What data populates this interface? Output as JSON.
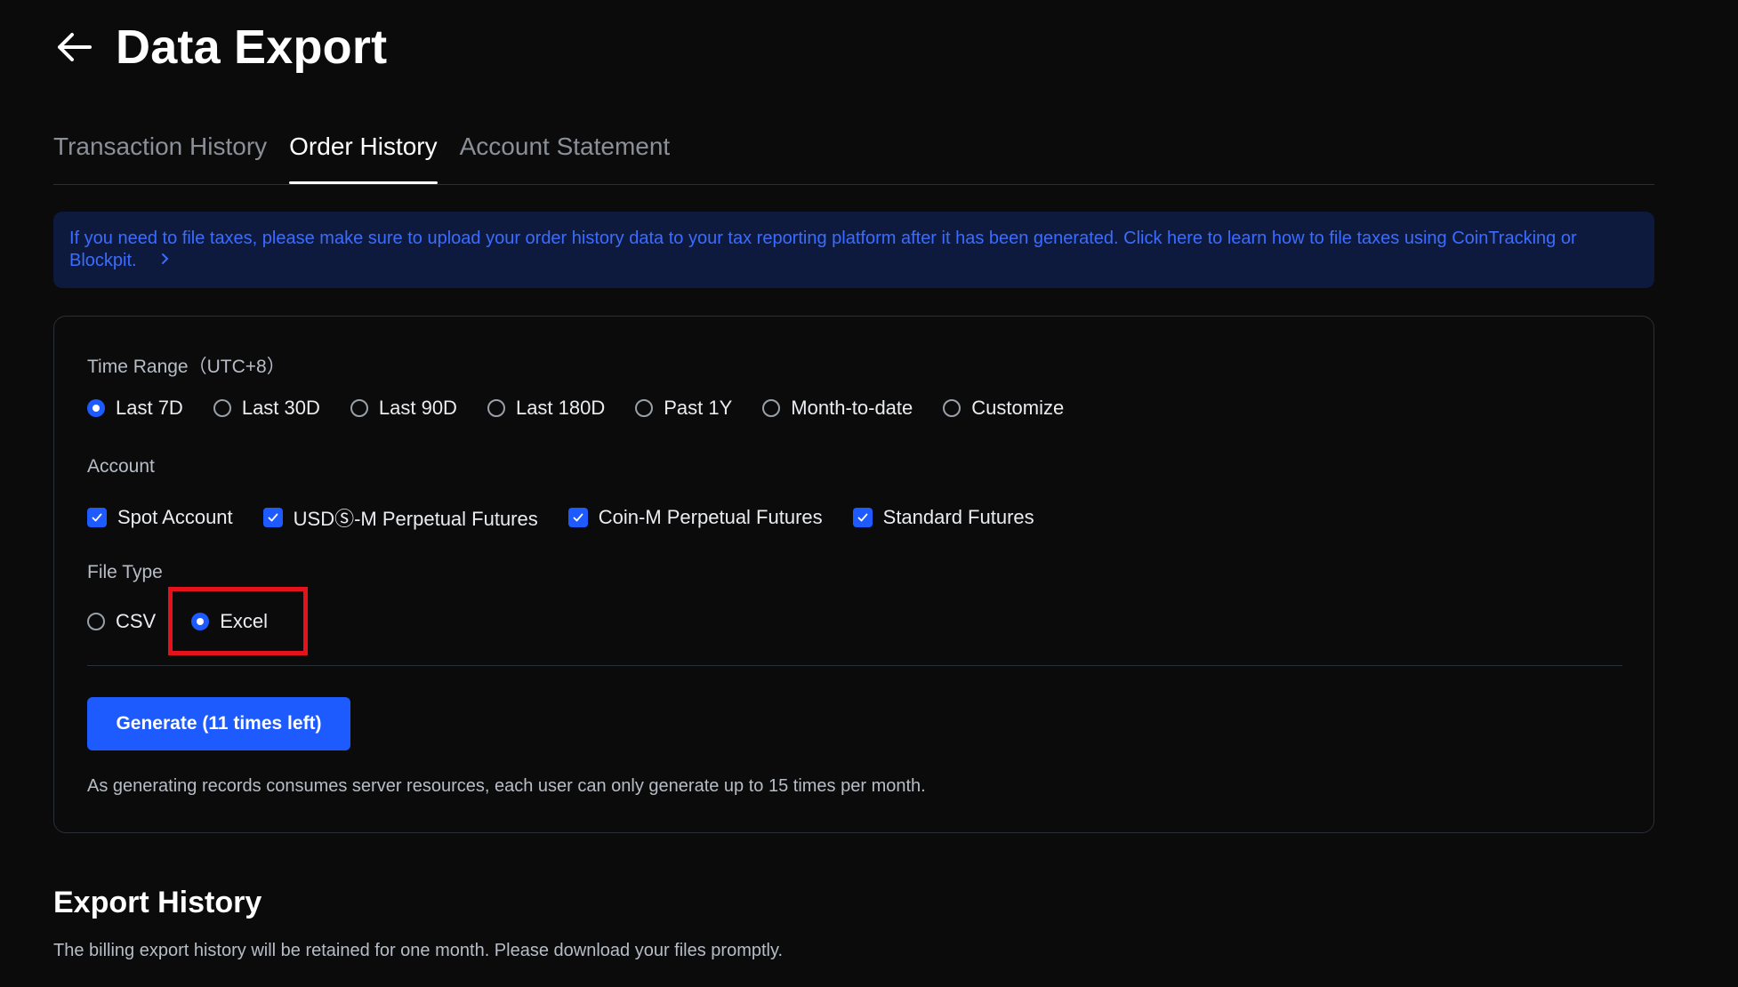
{
  "header": {
    "title": "Data Export",
    "back_icon": "arrow-left-icon"
  },
  "tabs": [
    {
      "label": "Transaction History",
      "active": false
    },
    {
      "label": "Order History",
      "active": true
    },
    {
      "label": "Account Statement",
      "active": false
    }
  ],
  "notice": {
    "text": "If you need to file taxes, please make sure to upload your order history data to your tax reporting platform after it has been generated. Click here to learn how to file taxes using CoinTracking or Blockpit.",
    "icon": "chevron-right-icon"
  },
  "form": {
    "time_range": {
      "label": "Time Range（UTC+8）",
      "options": [
        "Last 7D",
        "Last 30D",
        "Last 90D",
        "Last 180D",
        "Past 1Y",
        "Month-to-date",
        "Customize"
      ],
      "selected": "Last 7D"
    },
    "account": {
      "label": "Account",
      "options": [
        {
          "label": "Spot Account",
          "checked": true
        },
        {
          "label": "USDⓈ-M Perpetual Futures",
          "checked": true
        },
        {
          "label": "Coin-M Perpetual Futures",
          "checked": true
        },
        {
          "label": "Standard Futures",
          "checked": true
        }
      ]
    },
    "file_type": {
      "label": "File Type",
      "options": [
        "CSV",
        "Excel"
      ],
      "selected": "Excel"
    },
    "generate_label": "Generate (11 times left)",
    "limit_note": "As generating records consumes server resources, each user can only generate up to 15 times per month."
  },
  "export_history": {
    "title": "Export History",
    "description": "The billing export history will be retained for one month. Please download your files promptly."
  },
  "colors": {
    "accent": "#1e5bff",
    "notice_bg": "#0e1a3d",
    "notice_text": "#3b6cff",
    "highlight": "#e3121b",
    "background": "#0b0b0c"
  }
}
